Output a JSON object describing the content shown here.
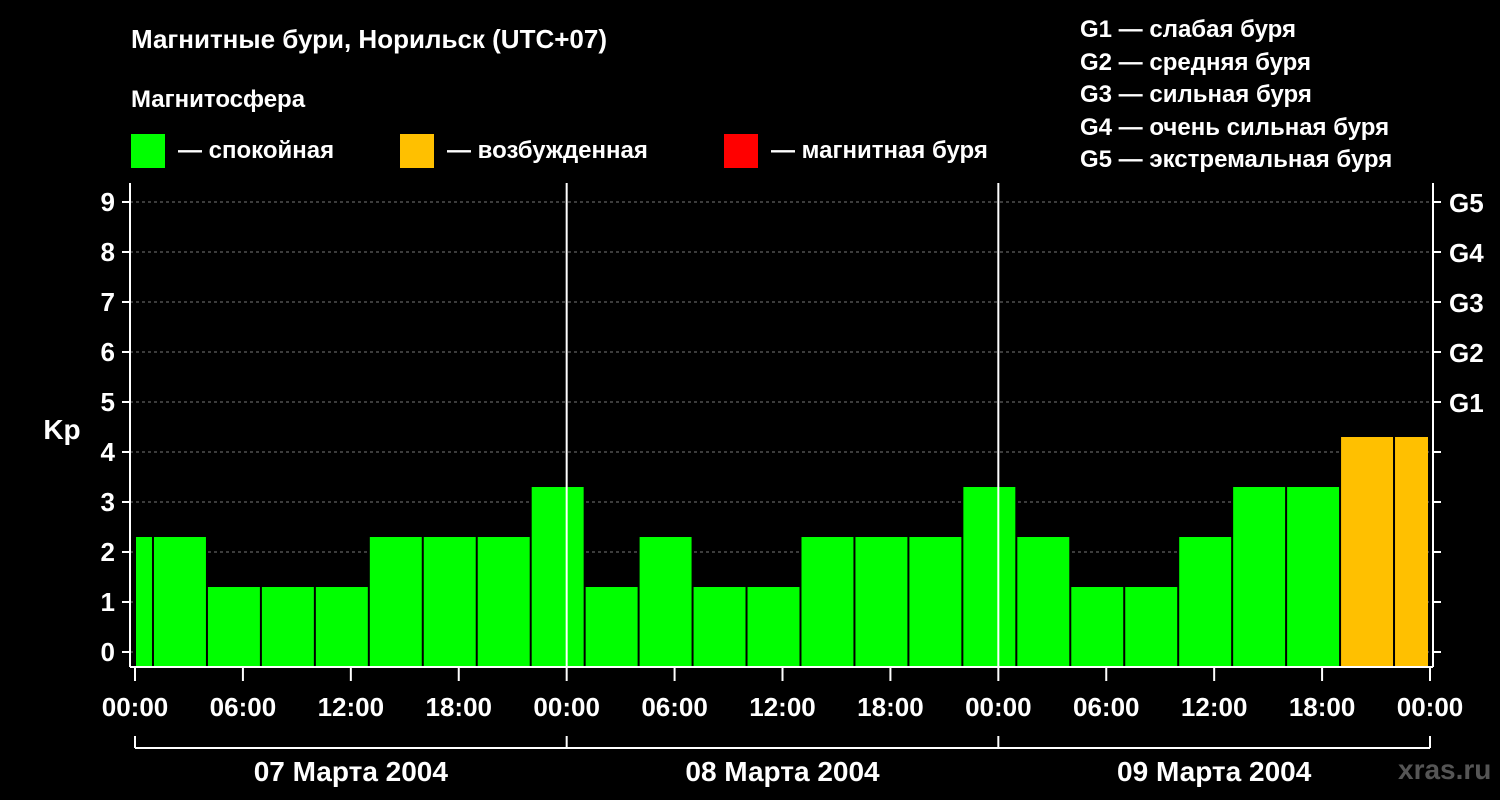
{
  "header": {
    "title": "Магнитные бури, Норильск (UTC+07)",
    "subtitle": "Магнитосфера"
  },
  "legend": [
    {
      "label": "— спокойная",
      "color": "#00ff00"
    },
    {
      "label": "— возбужденная",
      "color": "#ffc000"
    },
    {
      "label": "— магнитная буря",
      "color": "#ff0000"
    }
  ],
  "storm_levels": [
    "G1 — слабая буря",
    "G2 — средняя буря",
    "G3 — сильная буря",
    "G4 — очень сильная буря",
    "G5 — экстремальная буря"
  ],
  "watermark": "xras.ru",
  "chart_data": {
    "type": "bar",
    "ylabel": "Kp",
    "ylim": [
      0,
      9
    ],
    "yticks": [
      0,
      1,
      2,
      3,
      4,
      5,
      6,
      7,
      8,
      9
    ],
    "right_labels": [
      {
        "kp": 5,
        "label": "G1"
      },
      {
        "kp": 6,
        "label": "G2"
      },
      {
        "kp": 7,
        "label": "G3"
      },
      {
        "kp": 8,
        "label": "G4"
      },
      {
        "kp": 9,
        "label": "G5"
      }
    ],
    "xlim_hours": [
      0,
      72
    ],
    "x_tick_labels": [
      "00:00",
      "06:00",
      "12:00",
      "18:00",
      "00:00",
      "06:00",
      "12:00",
      "18:00",
      "00:00",
      "06:00",
      "12:00",
      "18:00",
      "00:00"
    ],
    "dates": [
      "07 Марта 2004",
      "08 Марта 2004",
      "09 Марта 2004"
    ],
    "bar_interval_hours": 3,
    "bar_start_offset_hours": -2,
    "values": [
      2,
      2,
      1,
      1,
      1,
      2,
      2,
      2,
      3,
      1,
      2,
      1,
      1,
      2,
      2,
      2,
      3,
      2,
      1,
      1,
      2,
      3,
      3,
      4,
      4
    ],
    "colors": {
      "quiet": "#00ff00",
      "active": "#ffc000",
      "storm": "#ff0000"
    },
    "grid": true
  }
}
